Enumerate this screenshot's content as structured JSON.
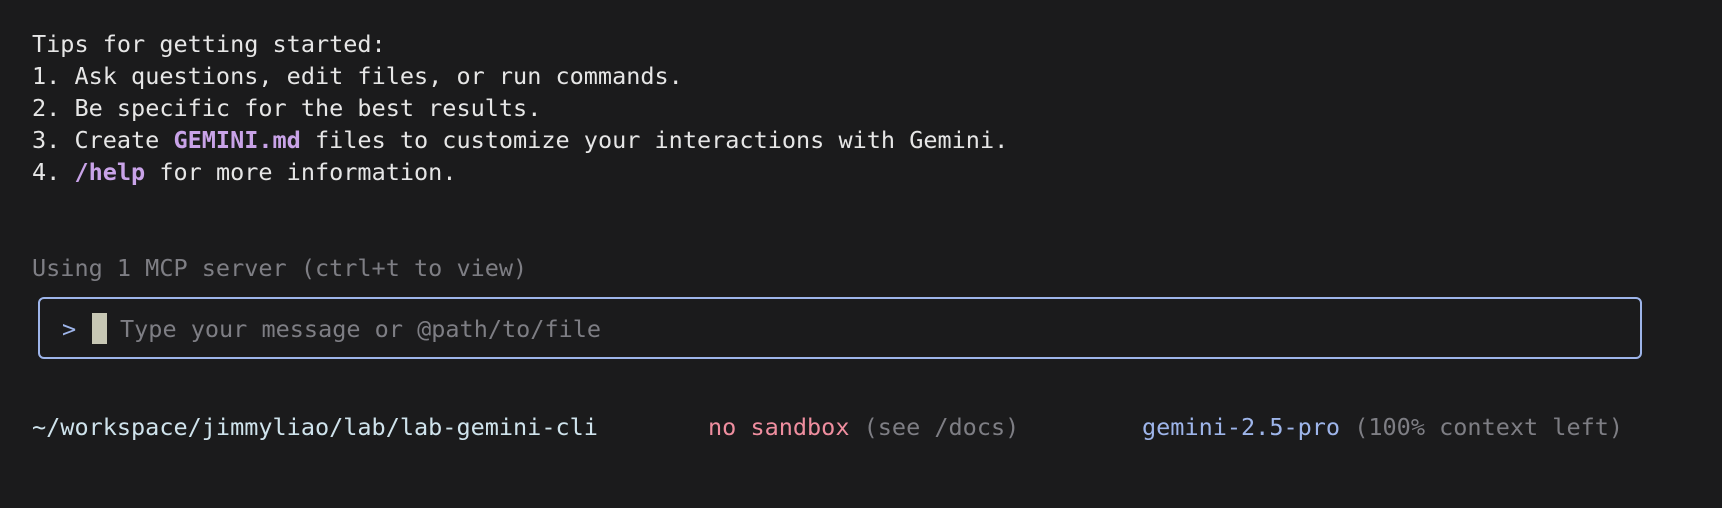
{
  "tips": {
    "heading": "Tips for getting started:",
    "items": [
      {
        "prefix": "1. ",
        "text": "Ask questions, edit files, or run commands."
      },
      {
        "prefix": "2. ",
        "text": "Be specific for the best results."
      },
      {
        "prefix": "3. Create ",
        "highlight": "GEMINI.md",
        "suffix": " files to customize your interactions with Gemini."
      },
      {
        "prefix": "4. ",
        "highlight": "/help",
        "suffix": " for more information."
      }
    ]
  },
  "mcp_status": "Using 1 MCP server (ctrl+t to view)",
  "prompt": {
    "symbol": ">",
    "value": "",
    "placeholder": "Type your message or @path/to/file"
  },
  "footer": {
    "cwd": "~/workspace/jimmyliao/lab/lab-gemini-cli",
    "sandbox": "no sandbox",
    "sandbox_note": "(see /docs)",
    "model": "gemini-2.5-pro",
    "context": "(100% context left)"
  },
  "colors": {
    "background": "#1b1b1c",
    "text": "#e6e6e6",
    "highlight": "#c9a3e8",
    "muted": "#7e7e84",
    "accent_blue": "#9eb5ea",
    "warn_pink": "#ef8e9f",
    "cursor": "#c7c7b4"
  }
}
